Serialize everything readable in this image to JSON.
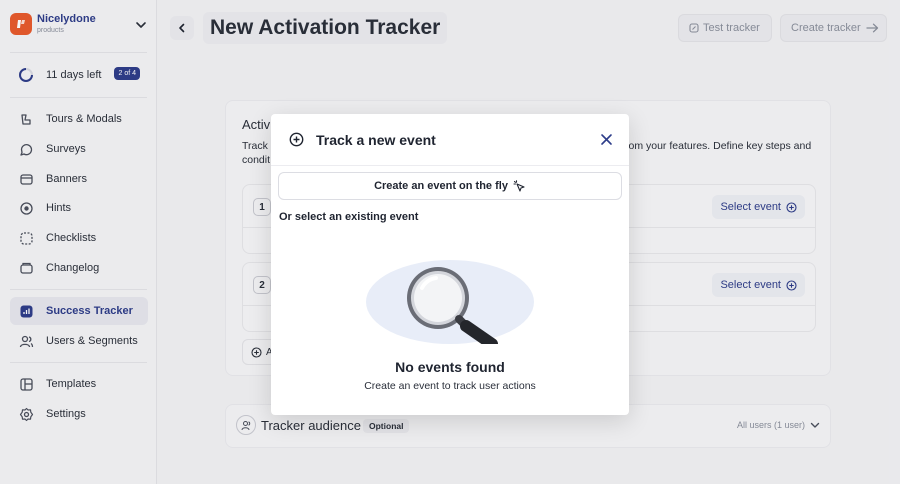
{
  "brand": {
    "name": "Nicelydone",
    "sub": "products"
  },
  "trial": {
    "days_left": "11 days left",
    "badge": "2 of 4"
  },
  "nav": {
    "items": [
      {
        "label": "Tours & Modals",
        "icon": "tours-icon"
      },
      {
        "label": "Surveys",
        "icon": "surveys-icon"
      },
      {
        "label": "Banners",
        "icon": "banners-icon"
      },
      {
        "label": "Hints",
        "icon": "hints-icon"
      },
      {
        "label": "Checklists",
        "icon": "checklists-icon"
      },
      {
        "label": "Changelog",
        "icon": "changelog-icon"
      },
      {
        "label": "Success Tracker",
        "icon": "success-tracker-icon",
        "active": true
      },
      {
        "label": "Users & Segments",
        "icon": "users-icon"
      },
      {
        "label": "Templates",
        "icon": "templates-icon"
      },
      {
        "label": "Settings",
        "icon": "settings-icon"
      }
    ]
  },
  "header": {
    "title": "New Activation Tracker",
    "test_label": "Test tracker",
    "create_label": "Create tracker"
  },
  "card": {
    "title": "Activ",
    "desc_left": "Track",
    "desc_right": "rom your features. Define key steps and",
    "desc_line2": "condit",
    "steps": [
      {
        "number": "1",
        "select_label": "Select event"
      },
      {
        "number": "2",
        "select_label": "Select event"
      }
    ],
    "add_label": "A"
  },
  "audience": {
    "title": "Tracker audience",
    "optional": "Optional",
    "summary": "All users (1 user)"
  },
  "modal": {
    "title": "Track a new event",
    "create_fly": "Create an event on the fly",
    "or_select": "Or select an existing event",
    "empty_title": "No events found",
    "empty_sub": "Create an event to track user actions"
  },
  "colors": {
    "brand_navy": "#2e3d8a",
    "logo_orange": "#e85a2c"
  }
}
